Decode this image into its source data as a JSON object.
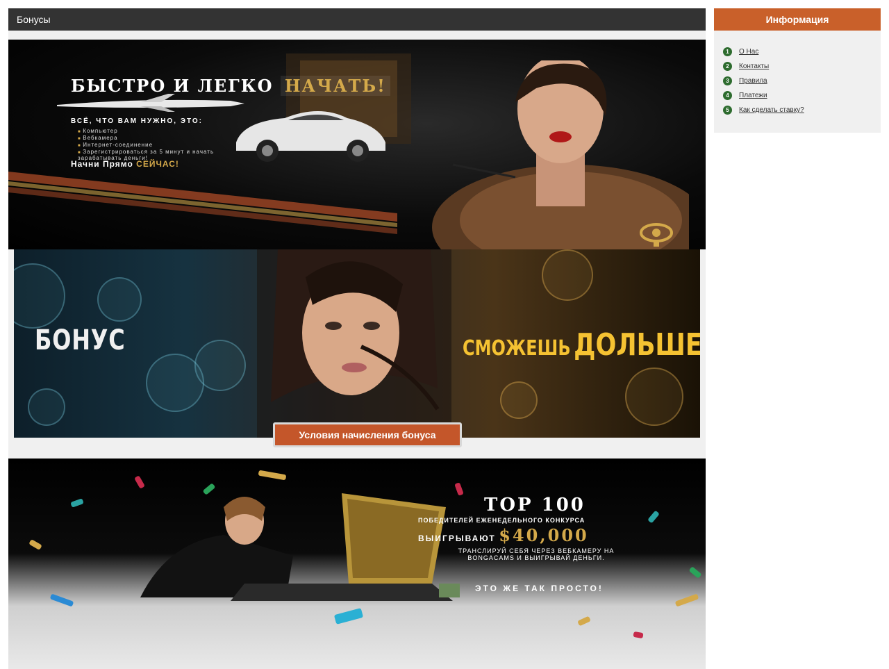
{
  "header": {
    "title": "Бонусы"
  },
  "banner1": {
    "title_white": "БЫСТРО И ЛЕГКО",
    "title_gold": "НАЧАТЬ!",
    "subtitle": "ВСЁ, ЧТО ВАМ НУЖНО, ЭТО:",
    "items": [
      "Компьютер",
      "Вебкамера",
      "Интернет-соединение",
      "Зарегистрироваться за 5 минут и начать зарабатывать деньги!"
    ],
    "cta_white": "Начни Прямо",
    "cta_gold": "СЕЙЧАС!"
  },
  "banner2": {
    "left_text": "БОНУС",
    "right_text_small": "СМОЖЕШЬ",
    "right_text_big": "ДОЛЬШЕ",
    "button_label": "Условия начисления бонуса"
  },
  "banner3": {
    "top": "TOP 100",
    "line2": "ПОБЕДИТЕЛЕЙ ЕЖЕНЕДЕЛЬНОГО КОНКУРСА",
    "line3a": "ВЫИГРЫВАЮТ",
    "line3b": "$40,000",
    "line4": "ТРАНСЛИРУЙ СЕБЯ ЧЕРЕЗ ВЕБКАМЕРУ НА BONGACAMS И ВЫИГРЫВАЙ ДЕНЬГИ.",
    "line5": "ЭТО ЖЕ ТАК ПРОСТО!"
  },
  "sidebar": {
    "title": "Информация",
    "items": [
      {
        "num": "1",
        "label": "О Нас"
      },
      {
        "num": "2",
        "label": "Контакты"
      },
      {
        "num": "3",
        "label": "Правила"
      },
      {
        "num": "4",
        "label": "Платежи"
      },
      {
        "num": "5",
        "label": "Как сделать ставку?"
      }
    ]
  },
  "colors": {
    "header_bg": "#333333",
    "sidebar_head": "#c9602a",
    "button": "#c4562a",
    "bullet": "#2d6b2e",
    "gold": "#d4a94a",
    "yellow": "#f5c232"
  }
}
